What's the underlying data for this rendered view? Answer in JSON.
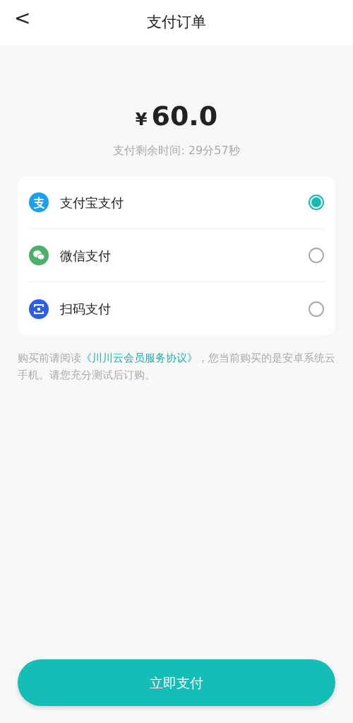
{
  "header": {
    "back": "<",
    "title": "支付订单"
  },
  "amount": {
    "currency": "¥",
    "value": "60.0",
    "remaining": "支付剩余时间: 29分57秒"
  },
  "methods": [
    {
      "kind": "alipay",
      "label": "支付宝支付",
      "selected": true
    },
    {
      "kind": "wechat",
      "label": "微信支付",
      "selected": false
    },
    {
      "kind": "scan",
      "label": "扫码支付",
      "selected": false
    }
  ],
  "notice": {
    "before": "购买前请阅读",
    "link": "《川川云会员服务协议》",
    "after": "，您当前购买的是安卓系统云手机。请您充分测试后订购。"
  },
  "pay_button": "立即支付"
}
